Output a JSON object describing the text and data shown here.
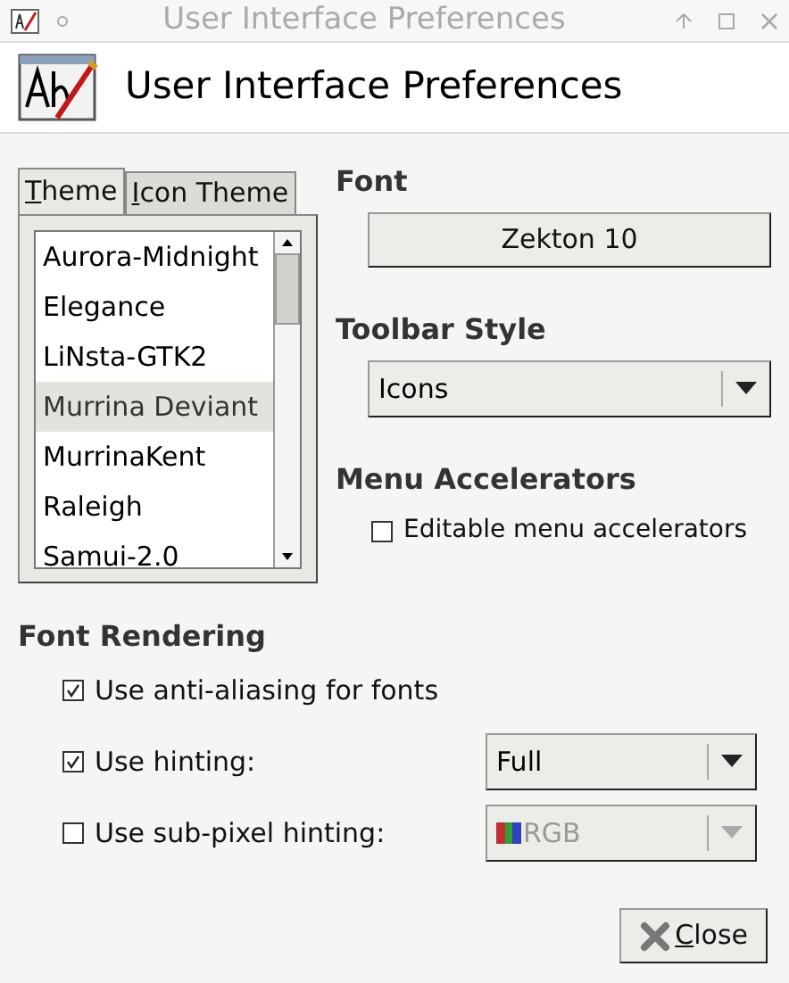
{
  "window": {
    "title": "User Interface Preferences"
  },
  "header": {
    "title": "User Interface Preferences"
  },
  "tabs": [
    {
      "label": "Theme",
      "selected": true
    },
    {
      "label": "Icon Theme",
      "selected": false
    }
  ],
  "themes": [
    {
      "name": "Aurora-Midnight",
      "selected": false
    },
    {
      "name": "Elegance",
      "selected": false
    },
    {
      "name": "LiNsta-GTK2",
      "selected": false
    },
    {
      "name": "Murrina Deviant",
      "selected": true
    },
    {
      "name": "MurrinaKent",
      "selected": false
    },
    {
      "name": "Raleigh",
      "selected": false
    },
    {
      "name": "Samui-2.0",
      "selected": false
    }
  ],
  "font": {
    "label": "Font",
    "value": "Zekton 10"
  },
  "toolbar_style": {
    "label": "Toolbar Style",
    "value": "Icons"
  },
  "menu_accelerators": {
    "label": "Menu Accelerators",
    "option": {
      "label": "Editable menu accelerators",
      "checked": false
    }
  },
  "font_rendering": {
    "label": "Font Rendering",
    "options": [
      {
        "label": "Use anti-aliasing for fonts",
        "checked": true
      },
      {
        "label": "Use hinting:",
        "checked": true,
        "select": {
          "value": "Full",
          "disabled": false
        }
      },
      {
        "label": "Use sub-pixel hinting:",
        "checked": false,
        "select": {
          "value": "RGB",
          "disabled": true,
          "swatch": true
        }
      }
    ]
  },
  "close_button": {
    "label": "Close"
  }
}
